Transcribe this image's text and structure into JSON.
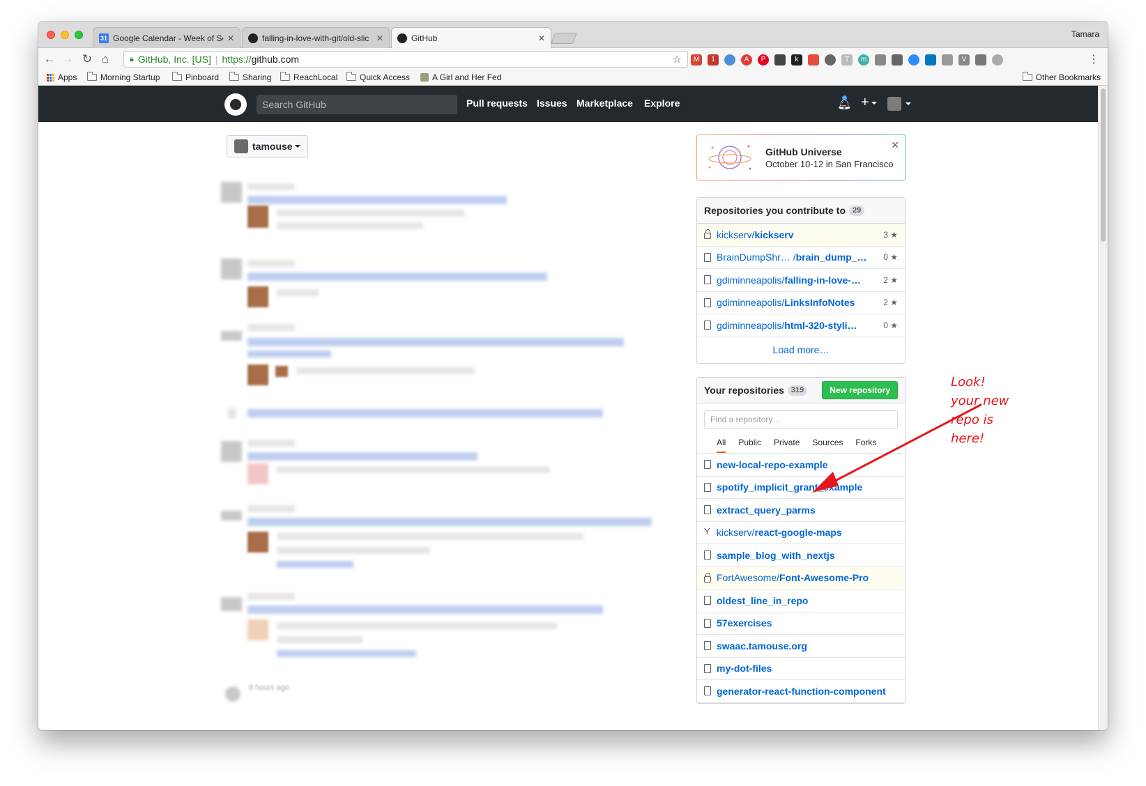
{
  "browser": {
    "tabs": [
      {
        "title": "Google Calendar - Week of Se",
        "icon": "calendar-icon",
        "fav": "31"
      },
      {
        "title": "falling-in-love-with-git/old-slic",
        "icon": "github-icon"
      },
      {
        "title": "GitHub",
        "icon": "github-icon"
      }
    ],
    "profile": "Tamara",
    "address": {
      "org": "GitHub, Inc. [US]",
      "scheme": "https://",
      "host": "github.com"
    },
    "bookmarks": [
      "Apps",
      "Morning Startup",
      "Pinboard",
      "Sharing",
      "ReachLocal",
      "Quick Access",
      "A Girl and Her Fed"
    ],
    "other_bookmarks": "Other Bookmarks"
  },
  "github": {
    "search_placeholder": "Search GitHub",
    "nav": [
      "Pull requests",
      "Issues",
      "Marketplace",
      "Explore"
    ],
    "context_user": "tamouse",
    "feed_footer": "8 hours ago",
    "universe": {
      "title": "GitHub Universe",
      "subtitle": "October 10-12 in San Francisco"
    },
    "contribute": {
      "title": "Repositories you contribute to",
      "count": "29",
      "repos": [
        {
          "owner": "kickserv/",
          "name": "kickserv",
          "stars": "3",
          "private": true
        },
        {
          "owner": "BrainDumpShr… /",
          "name": "brain_dump_…",
          "stars": "0",
          "private": false
        },
        {
          "owner": "gdiminneapolis/",
          "name": "falling-in-love-…",
          "stars": "2",
          "private": false
        },
        {
          "owner": "gdiminneapolis/",
          "name": "LinksInfoNotes",
          "stars": "2",
          "private": false
        },
        {
          "owner": "gdiminneapolis/",
          "name": "html-320-styli…",
          "stars": "0",
          "private": false
        }
      ],
      "load_more": "Load more…"
    },
    "your_repos": {
      "title": "Your repositories",
      "count": "319",
      "new_button": "New repository",
      "filter_placeholder": "Find a repository…",
      "tabs": [
        "All",
        "Public",
        "Private",
        "Sources",
        "Forks"
      ],
      "repos": [
        {
          "owner": "",
          "name": "new-local-repo-example",
          "type": "repo"
        },
        {
          "owner": "",
          "name": "spotify_implicit_grant_example",
          "type": "repo"
        },
        {
          "owner": "",
          "name": "extract_query_parms",
          "type": "repo"
        },
        {
          "owner": "kickserv/",
          "name": "react-google-maps",
          "type": "fork"
        },
        {
          "owner": "",
          "name": "sample_blog_with_nextjs",
          "type": "repo"
        },
        {
          "owner": "FortAwesome/",
          "name": "Font-Awesome-Pro",
          "type": "private"
        },
        {
          "owner": "",
          "name": "oldest_line_in_repo",
          "type": "repo"
        },
        {
          "owner": "",
          "name": "57exercises",
          "type": "repo"
        },
        {
          "owner": "",
          "name": "swaac.tamouse.org",
          "type": "repo"
        },
        {
          "owner": "",
          "name": "my-dot-files",
          "type": "repo"
        },
        {
          "owner": "",
          "name": "generator-react-function-component",
          "type": "repo"
        }
      ]
    }
  },
  "annotation": [
    "Look!",
    "your new",
    "repo is",
    "here!"
  ],
  "colors": {
    "annotation": "#e5171c",
    "gh_header": "#24292e",
    "link": "#0366d6",
    "new_button": "#2cbe4e"
  }
}
